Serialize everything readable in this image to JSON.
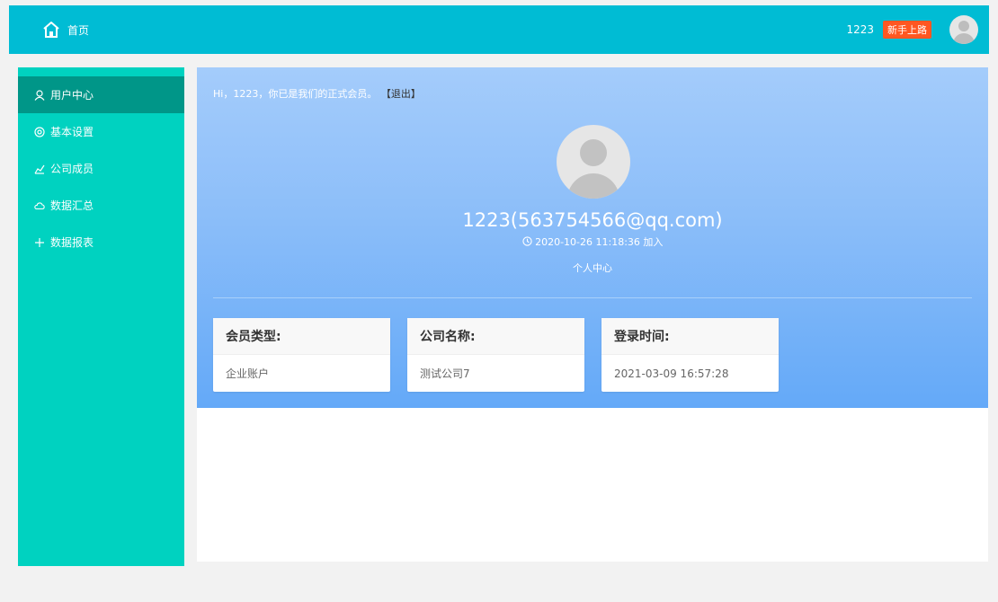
{
  "topbar": {
    "home_label": "首页",
    "username": "1223",
    "badge": "新手上路",
    "bg_color": "#00bcd4",
    "badge_color": "#ff5722"
  },
  "sidebar": {
    "bg_color": "#00d2c0",
    "active_color": "#009688",
    "items": [
      {
        "label": "用户中心",
        "icon": "user-icon",
        "active": true
      },
      {
        "label": "基本设置",
        "icon": "settings-icon",
        "active": false
      },
      {
        "label": "公司成员",
        "icon": "chart-icon",
        "active": false
      },
      {
        "label": "数据汇总",
        "icon": "cloud-icon",
        "active": false
      },
      {
        "label": "数据报表",
        "icon": "plus-icon",
        "active": false
      }
    ]
  },
  "profile": {
    "greeting": "Hi，1223，你已是我们的正式会员。",
    "logout": "【退出】",
    "display_name": "1223(563754566@qq.com)",
    "joined": "2020-10-26 11:18:36 加入",
    "center_label": "个人中心"
  },
  "cards": [
    {
      "title": "会员类型:",
      "value": "企业账户"
    },
    {
      "title": "公司名称:",
      "value": "测试公司7"
    },
    {
      "title": "登录时间:",
      "value": "2021-03-09 16:57:28"
    }
  ]
}
